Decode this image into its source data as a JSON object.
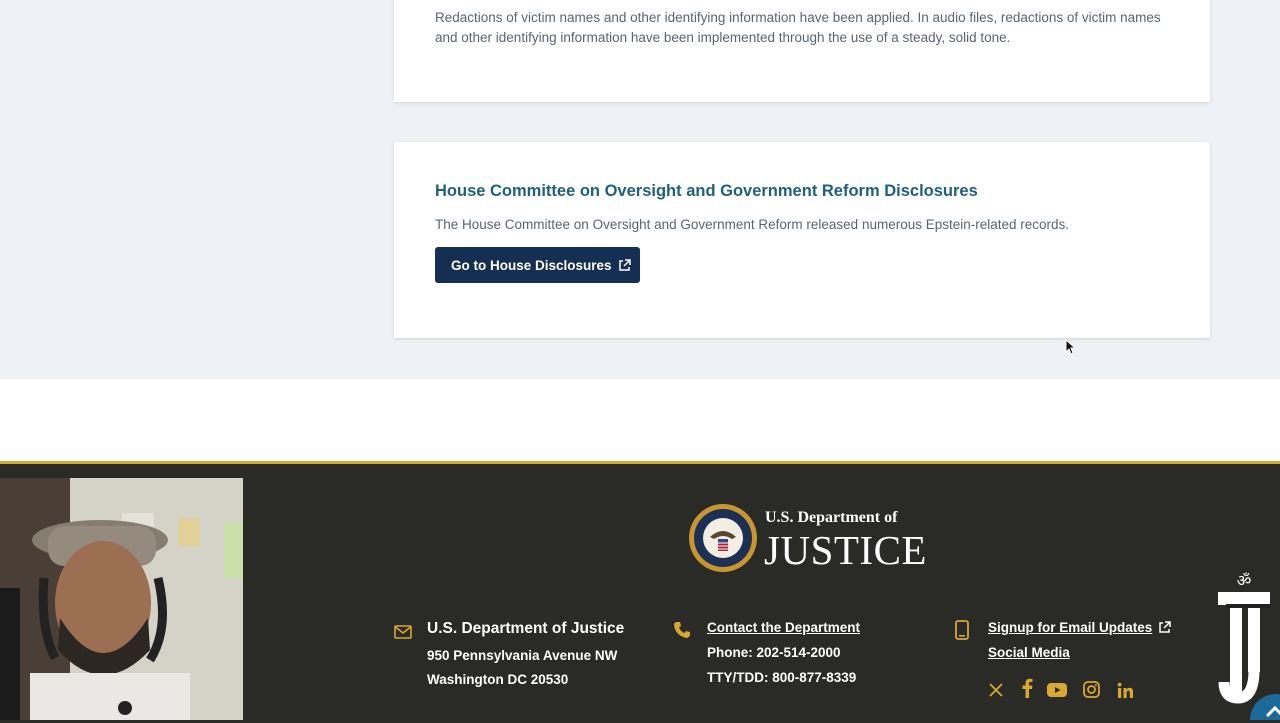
{
  "card_redaction": {
    "text": "Redactions of victim names and other identifying information have been applied. In audio files, redactions of victim names and other identifying information have been implemented through the use of a steady, solid tone."
  },
  "card_house": {
    "title": "House Committee on Oversight and Government Reform Disclosures",
    "description": "The House Committee on Oversight and Government Reform released numerous Epstein-related records.",
    "button_label": "Go to House Disclosures"
  },
  "footer": {
    "logo_top": "U.S. Department of",
    "logo_big": "JUSTICE",
    "address": {
      "title": "U.S. Department of Justice",
      "line1": "950 Pennsylvania Avenue NW",
      "line2": "Washington DC 20530"
    },
    "contact": {
      "link": "Contact the Department",
      "phone": "Phone: 202-514-2000",
      "tty": "TTY/TDD: 800-877-8339"
    },
    "updates": {
      "email_link": "Signup for Email Updates",
      "social_link": "Social Media"
    },
    "social_icons": [
      "x-icon",
      "facebook-icon",
      "youtube-icon",
      "instagram-icon",
      "linkedin-icon"
    ],
    "accent_color": "#d8a830"
  },
  "colors": {
    "button_bg": "#162e51",
    "title_color": "#1f5f7f",
    "footer_bg": "#2a2a27"
  }
}
